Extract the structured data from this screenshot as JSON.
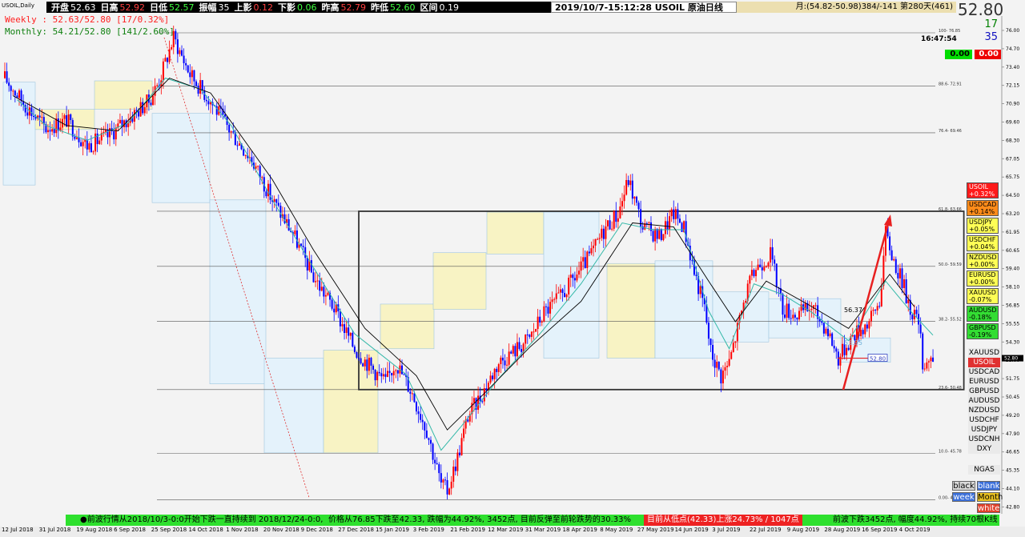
{
  "window": {
    "symbol_tag": "USOIL,Daily"
  },
  "quote_bar": [
    {
      "k": "开盘",
      "v": "52.63",
      "c": "#ffffff"
    },
    {
      "k": "日高",
      "v": "52.92",
      "c": "#ff4040"
    },
    {
      "k": "日低",
      "v": "52.57",
      "c": "#40ff40"
    },
    {
      "k": "振幅",
      "v": "35",
      "c": "#ffffff"
    },
    {
      "k": "上影",
      "v": "0.12",
      "c": "#ff4040"
    },
    {
      "k": "下影",
      "v": "0.06",
      "c": "#40ff40"
    },
    {
      "k": "昨高",
      "v": "52.79",
      "c": "#ff4040"
    },
    {
      "k": "昨低",
      "v": "52.60",
      "c": "#40ff40"
    },
    {
      "k": "区间",
      "v": "0.19",
      "c": "#ffffff"
    }
  ],
  "title": "2019/10/7-15:12:28  USOIL  原油日线",
  "range_info": "月:(54.82-50.98)384/-141  第280天(461)",
  "ma": {
    "weekly": "Weekly : 52.63/52.80 [17/0.32%]",
    "monthly": "Monthly: 54.21/52.80 [141/2.60%]"
  },
  "price": {
    "current": "52.80",
    "stat1": "17",
    "stat2": "35",
    "clock": "16:47:54"
  },
  "pnl": {
    "green": "0.00",
    "red": "0.00"
  },
  "colors": {
    "bull": "#ff0000",
    "bear": "#0000ff",
    "ma_fast": "#33b8a8",
    "ma_slow": "#000000",
    "ticker_bg": "#2ee02e",
    "box_yellow": "#f8f3c4",
    "box_blue": "#e4f2fb"
  },
  "board": [
    {
      "sym": "USOIL",
      "chg": "+0.32%",
      "bg": "#ff1a1a"
    },
    {
      "sym": "USDCAD",
      "chg": "+0.14%",
      "bg": "#ff8c1a"
    },
    {
      "sym": "USDJPY",
      "chg": "+0.05%",
      "bg": "#ffff55"
    },
    {
      "sym": "USDCHF",
      "chg": "+0.04%",
      "bg": "#ffff55"
    },
    {
      "sym": "NZDUSD",
      "chg": "+0.00%",
      "bg": "#ffff55"
    },
    {
      "sym": "EURUSD",
      "chg": "+0.00%",
      "bg": "#ffff55"
    },
    {
      "sym": "XAUUSD",
      "chg": "-0.07%",
      "bg": "#ffff55"
    },
    {
      "sym": "AUDUSD",
      "chg": "-0.18%",
      "bg": "#33dd33"
    },
    {
      "sym": "GBPUSD",
      "chg": "-0.19%",
      "bg": "#33dd33"
    }
  ],
  "symbols_a": [
    {
      "label": "XAUUSD",
      "active": false
    },
    {
      "label": "USOIL",
      "active": true
    },
    {
      "label": "USDCAD",
      "active": false
    },
    {
      "label": "EURUSD",
      "active": false
    },
    {
      "label": "GBPUSD",
      "active": false
    }
  ],
  "symbols_b": [
    "AUDUSD",
    "NZDUSD",
    "USDCHF",
    "USDJPY",
    "USDCNH",
    "DXY"
  ],
  "symbol_c": "NGAS",
  "modes": {
    "black": "black",
    "blank": "blank",
    "week": "week",
    "month": "Month",
    "white": "white"
  },
  "ticker": {
    "t1": "●前波行情从2018/10/3-0:0开始下跌一直持续到 2018/12/24-0:0,",
    "t2": "价格从76.85下跌至42.33, 跌幅为44.92%, 3452点, 目前反弹至前轮跌势的30.33%",
    "t3": "目前从低点(42.33)上涨24.73% / 1047点",
    "t4": "前波下跌3452点, 幅度44.92%, 持续70根K线"
  },
  "chart_data": {
    "type": "candlestick",
    "y_ticks": [
      "76.00",
      "74.70",
      "73.40",
      "72.15",
      "70.90",
      "69.60",
      "68.30",
      "67.05",
      "65.75",
      "64.50",
      "63.20",
      "61.95",
      "60.65",
      "59.40",
      "58.10",
      "56.85",
      "55.55",
      "54.30",
      "53.00",
      "51.75",
      "50.45",
      "49.20",
      "47.90",
      "46.65",
      "45.35",
      "44.10",
      "42.80"
    ],
    "y_range": [
      41.3,
      77.5
    ],
    "fib_levels": [
      {
        "label": "100- 76.85",
        "value": 76.85
      },
      {
        "label": "88.6- 72.91",
        "value": 72.91
      },
      {
        "label": "76.4- 69.46",
        "value": 69.46
      },
      {
        "label": "61.8- 63.66",
        "value": 63.66
      },
      {
        "label": "50.0- 59.59",
        "value": 59.59
      },
      {
        "label": "38.2- 55.52",
        "value": 55.52
      },
      {
        "label": "23.6- 50.48",
        "value": 50.48
      },
      {
        "label": "10.0- 45.78",
        "value": 45.78
      },
      {
        "label": "0.00- 42.33",
        "value": 42.33
      }
    ],
    "x_labels": [
      "12 Jul 2018",
      "31 Jul 2018",
      "19 Aug 2018",
      "6 Sep 2018",
      "25 Sep 2018",
      "14 Oct 2018",
      "1 Nov 2018",
      "20 Nov 2018",
      "9 Dec 2018",
      "27 Dec 2018",
      "15 Jan 2019",
      "3 Feb 2019",
      "21 Feb 2019",
      "12 Mar 2019",
      "31 Mar 2019",
      "18 Apr 2019",
      "8 May 2019",
      "27 May 2019",
      "14 Jun 2019",
      "3 Jul 2019",
      "22 Jul 2019",
      "9 Aug 2019",
      "28 Aug 2019",
      "16 Sep 2019",
      "4 Oct 2019"
    ],
    "anchors": [
      [
        0,
        73.5
      ],
      [
        10,
        71.5
      ],
      [
        20,
        69.8
      ],
      [
        30,
        70.4
      ],
      [
        40,
        68.5
      ],
      [
        50,
        69.2
      ],
      [
        60,
        70.5
      ],
      [
        70,
        71.8
      ],
      [
        75,
        73.3
      ],
      [
        82,
        76.5
      ],
      [
        90,
        73.8
      ],
      [
        100,
        71.8
      ],
      [
        110,
        69.5
      ],
      [
        120,
        67.5
      ],
      [
        130,
        64.5
      ],
      [
        140,
        62.0
      ],
      [
        150,
        58.8
      ],
      [
        160,
        56.5
      ],
      [
        170,
        53.5
      ],
      [
        180,
        51.8
      ],
      [
        185,
        51.0
      ],
      [
        190,
        52.5
      ],
      [
        198,
        50.2
      ],
      [
        205,
        47.5
      ],
      [
        212,
        43.5
      ],
      [
        215,
        43.0
      ],
      [
        220,
        45.5
      ],
      [
        225,
        48.5
      ],
      [
        232,
        50.2
      ],
      [
        240,
        52.5
      ],
      [
        248,
        53.4
      ],
      [
        255,
        54.3
      ],
      [
        262,
        56.2
      ],
      [
        270,
        57.3
      ],
      [
        278,
        59.0
      ],
      [
        285,
        60.5
      ],
      [
        292,
        62.5
      ],
      [
        298,
        63.5
      ],
      [
        303,
        66.0
      ],
      [
        310,
        62.5
      ],
      [
        318,
        61.8
      ],
      [
        325,
        63.5
      ],
      [
        330,
        62.5
      ],
      [
        335,
        59.2
      ],
      [
        340,
        56.5
      ],
      [
        343,
        53.3
      ],
      [
        348,
        51.5
      ],
      [
        352,
        52.5
      ],
      [
        360,
        57.5
      ],
      [
        365,
        59.5
      ],
      [
        372,
        60.5
      ],
      [
        378,
        56.5
      ],
      [
        385,
        56.0
      ],
      [
        392,
        56.6
      ],
      [
        400,
        54.8
      ],
      [
        405,
        52.8
      ],
      [
        412,
        54.5
      ],
      [
        420,
        55.5
      ],
      [
        425,
        57.0
      ],
      [
        428,
        62.0
      ],
      [
        432,
        60.0
      ],
      [
        436,
        58.5
      ],
      [
        440,
        56.5
      ],
      [
        444,
        55.5
      ],
      [
        446,
        52.5
      ],
      [
        451,
        52.8
      ]
    ],
    "ma_fast": [
      [
        6,
        71.9
      ],
      [
        20,
        70.0
      ],
      [
        40,
        68.9
      ],
      [
        60,
        70.2
      ],
      [
        78,
        73.5
      ],
      [
        95,
        72.7
      ],
      [
        110,
        70.0
      ],
      [
        130,
        64.5
      ],
      [
        150,
        59.5
      ],
      [
        170,
        54.6
      ],
      [
        195,
        51.6
      ],
      [
        212,
        46.0
      ],
      [
        222,
        47.8
      ],
      [
        240,
        51.3
      ],
      [
        260,
        54.6
      ],
      [
        280,
        58.3
      ],
      [
        300,
        62.8
      ],
      [
        315,
        62.3
      ],
      [
        330,
        62.3
      ],
      [
        342,
        56.3
      ],
      [
        352,
        53.5
      ],
      [
        364,
        58.3
      ],
      [
        378,
        57.5
      ],
      [
        392,
        56.2
      ],
      [
        410,
        54.1
      ],
      [
        428,
        58.5
      ],
      [
        440,
        56.3
      ],
      [
        451,
        54.5
      ]
    ],
    "ma_slow": [
      [
        4,
        72.2
      ],
      [
        30,
        70.0
      ],
      [
        55,
        69.6
      ],
      [
        80,
        73.5
      ],
      [
        100,
        72.4
      ],
      [
        130,
        66.0
      ],
      [
        150,
        60.8
      ],
      [
        175,
        55.0
      ],
      [
        200,
        51.5
      ],
      [
        215,
        47.5
      ],
      [
        235,
        50.5
      ],
      [
        255,
        53.6
      ],
      [
        280,
        57.0
      ],
      [
        305,
        62.8
      ],
      [
        325,
        62.5
      ],
      [
        342,
        58.5
      ],
      [
        355,
        55.5
      ],
      [
        370,
        58.5
      ],
      [
        390,
        56.8
      ],
      [
        410,
        55.0
      ],
      [
        430,
        59.0
      ],
      [
        442,
        56.6
      ]
    ],
    "box_rect": {
      "x0": 172,
      "x1": 466,
      "top": 63.66,
      "bottom": 50.48
    },
    "annotations": [
      {
        "text": "56.37",
        "value": 56.37
      },
      {
        "text": "53.95",
        "value": 53.95
      },
      {
        "text": "52.80",
        "value": 52.8
      }
    ]
  }
}
